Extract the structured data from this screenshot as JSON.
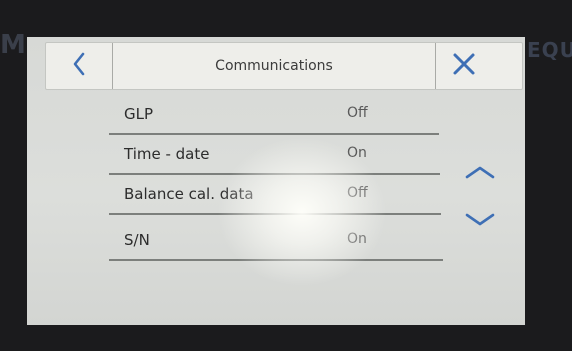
{
  "colors": {
    "accent": "#3e6fb5",
    "header_bg": "#eeeeea",
    "screen_bg": "#d9dbd8",
    "bezel": "#1b1b1d"
  },
  "header": {
    "title": "Communications",
    "back_icon": "chevron-left-icon",
    "close_icon": "close-icon"
  },
  "settings": [
    {
      "label": "GLP",
      "value": "Off"
    },
    {
      "label": "Time - date",
      "value": "On"
    },
    {
      "label": "Balance cal. data",
      "value": "Off"
    },
    {
      "label": "S/N",
      "value": "On"
    }
  ],
  "scroll": {
    "up_icon": "chevron-up-icon",
    "down_icon": "chevron-down-icon"
  },
  "background_text": {
    "left": "M",
    "right": "EQU"
  }
}
